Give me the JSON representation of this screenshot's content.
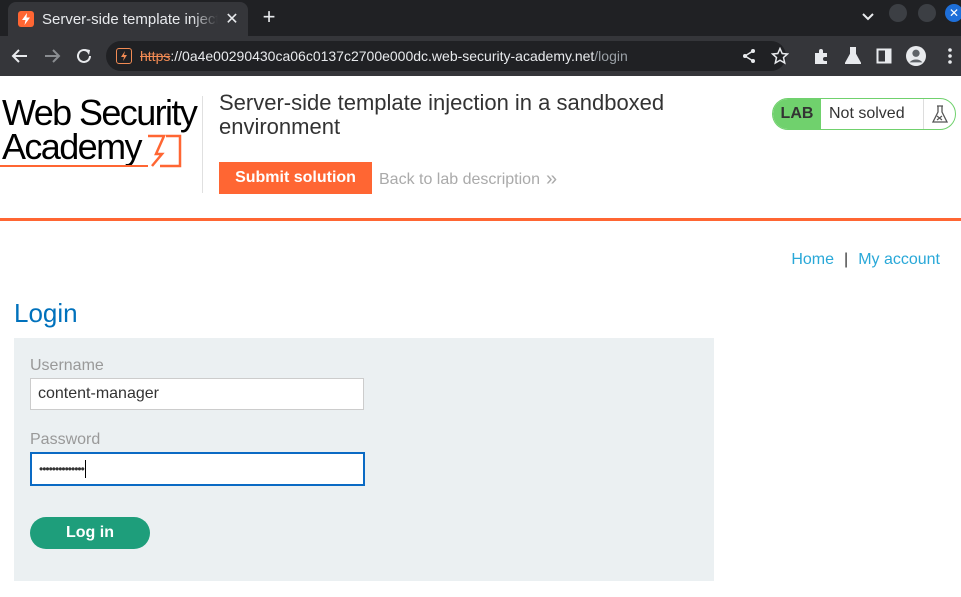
{
  "browser": {
    "tab_title": "Server-side template injection in a sandboxed environment",
    "tab_close": "✕",
    "new_tab": "+",
    "url_scheme": "https",
    "url_host": "://0a4e00290430ca06c0137c2700e000dc.web-security-academy.net",
    "url_path": "/login"
  },
  "header": {
    "logo_line1": "Web Security",
    "logo_line2": "Academy",
    "lab_title": "Server-side template injection in a sandboxed environment",
    "submit_label": "Submit solution",
    "back_label": "Back to lab description",
    "back_chevron": "»",
    "lab_badge": "LAB",
    "lab_status": "Not solved"
  },
  "nav": {
    "home": "Home",
    "separator": "|",
    "my_account": "My account"
  },
  "login": {
    "title": "Login",
    "username_label": "Username",
    "username_value": "content-manager",
    "password_label": "Password",
    "password_value": "••••••••••••••",
    "submit_label": "Log in"
  },
  "colors": {
    "accent": "#ff6633",
    "link": "#29a8d8",
    "title": "#0071bc",
    "button": "#1e9e7b",
    "lab_green": "#70d16d"
  }
}
